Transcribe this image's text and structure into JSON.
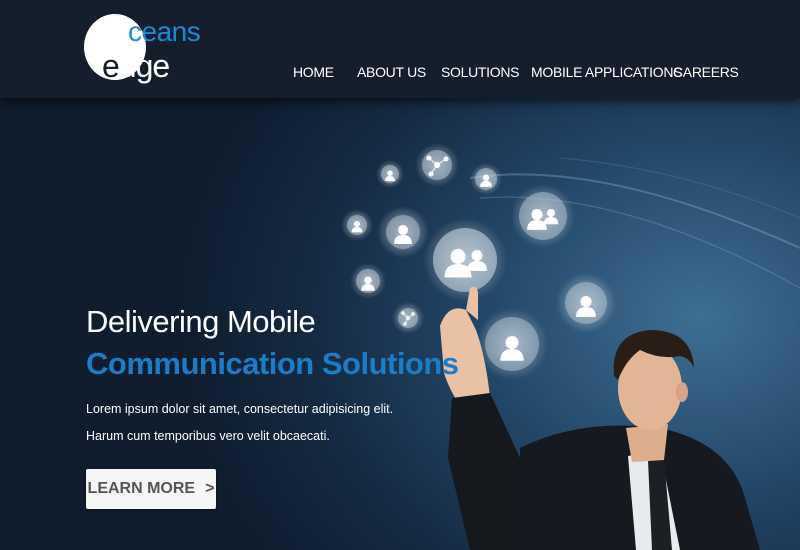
{
  "brand": {
    "logo_top": "ceans",
    "logo_bottom_first": "e",
    "logo_bottom_rest": "dge"
  },
  "nav": {
    "items": [
      "HOME",
      "ABOUT US",
      "SOLUTIONS",
      "MOBILE APPLICATIONS",
      "CAREERS"
    ]
  },
  "hero": {
    "headline_line1": "Delivering Mobile",
    "headline_line2": "Communication Solutions",
    "description": "Lorem ipsum dolor sit amet, consectetur adipisicing elit. Harum cum temporibus vero velit obcaecati.",
    "button_label": "LEARN MORE",
    "button_chevron": ">"
  },
  "colors": {
    "header_bg": "#141e2c",
    "accent_blue": "#1d7cc6",
    "button_bg": "#f5f5f5"
  },
  "icons": [
    "network-node-icon",
    "user-icon",
    "user-group-icon"
  ]
}
